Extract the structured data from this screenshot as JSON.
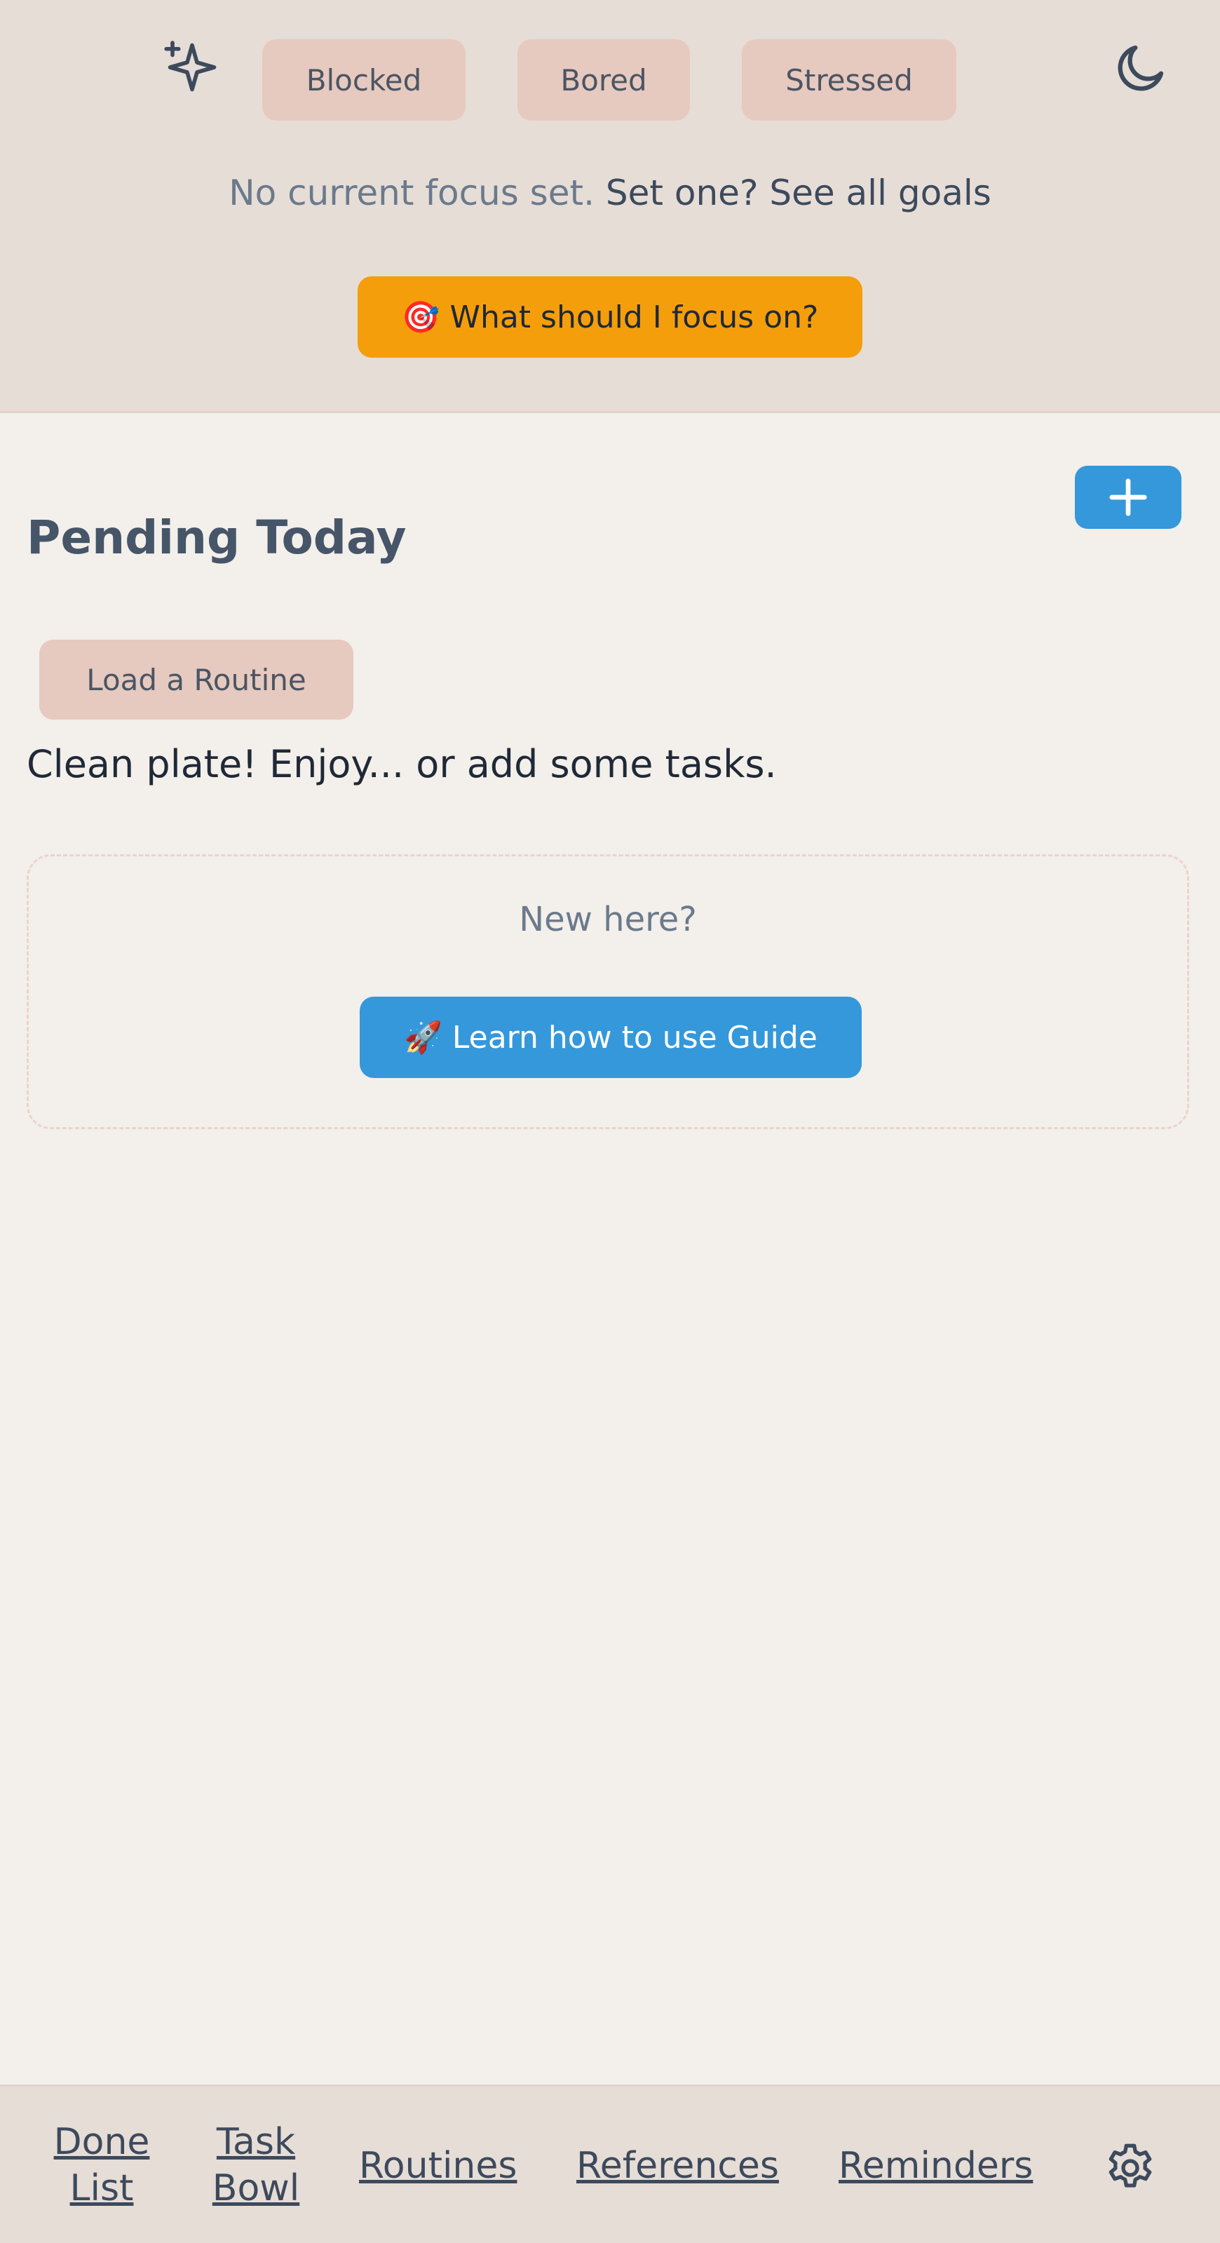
{
  "header": {
    "icons": {
      "left": "sparkle-icon",
      "right": "moon-icon"
    },
    "moods": [
      "Blocked",
      "Bored",
      "Stressed"
    ],
    "focus_status": "No current focus set.",
    "set_focus_link": "Set one?",
    "see_goals_link": "See all goals",
    "focus_button": {
      "emoji": "🎯",
      "label": "What should I focus on?"
    }
  },
  "main": {
    "add_button_icon": "plus-icon",
    "title": "Pending Today",
    "load_routine_label": "Load a Routine",
    "empty_message": "Clean plate! Enjoy... or add some tasks.",
    "welcome": {
      "text": "New here?",
      "guide_button": {
        "emoji": "🚀",
        "label": "Learn how to use Guide"
      }
    }
  },
  "bottom_nav": {
    "done_list": [
      "Done",
      "List"
    ],
    "task_bowl": [
      "Task",
      "Bowl"
    ],
    "routines": "Routines",
    "references": "References",
    "reminders": "Reminders",
    "settings_icon": "gear-icon"
  },
  "colors": {
    "header_bg": "#e6ddd7",
    "page_bg": "#f3efea",
    "mood_button_bg": "#e6c9bf",
    "focus_button_bg": "#f59e0b",
    "primary_blue": "#3498db",
    "title_color": "#475569"
  }
}
